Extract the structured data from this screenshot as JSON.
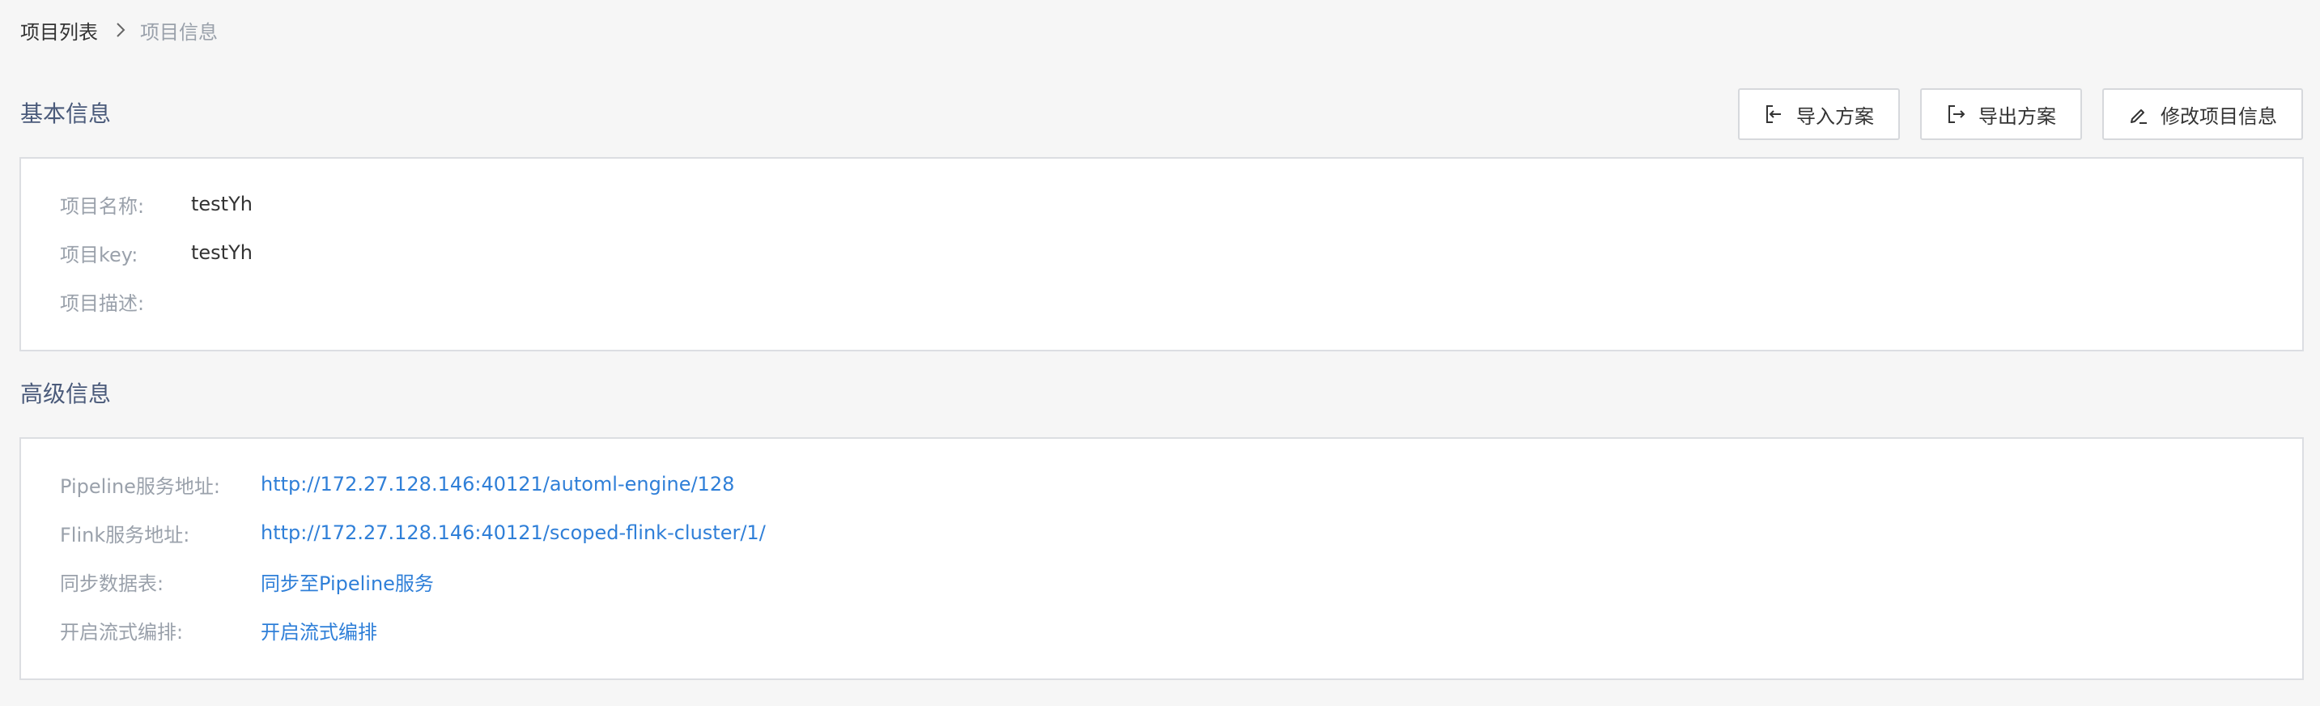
{
  "breadcrumb": {
    "parent": "项目列表",
    "current": "项目信息"
  },
  "basic": {
    "title": "基本信息",
    "actions": {
      "import_label": "导入方案",
      "export_label": "导出方案",
      "edit_label": "修改项目信息"
    },
    "fields": [
      {
        "label": "项目名称:",
        "value": "testYh"
      },
      {
        "label": "项目key:",
        "value": "testYh"
      },
      {
        "label": "项目描述:",
        "value": ""
      }
    ]
  },
  "advanced": {
    "title": "高级信息",
    "fields": [
      {
        "label": "Pipeline服务地址:",
        "value": "http://172.27.128.146:40121/automl-engine/128"
      },
      {
        "label": "Flink服务地址:",
        "value": "http://172.27.128.146:40121/scoped-flink-cluster/1/"
      },
      {
        "label": "同步数据表:",
        "value": "同步至Pipeline服务"
      },
      {
        "label": "开启流式编排:",
        "value": "开启流式编排"
      }
    ]
  },
  "icons": {
    "breadcrumb_separator": "chevron-right-icon",
    "import": "import-icon",
    "export": "export-icon",
    "edit": "edit-icon"
  },
  "colors": {
    "background": "#f6f6f6",
    "panel": "#ffffff",
    "link": "#2f7fd8",
    "label": "#9aa1ab",
    "section_title": "#4a5a7a",
    "border": "#dcdee2"
  }
}
